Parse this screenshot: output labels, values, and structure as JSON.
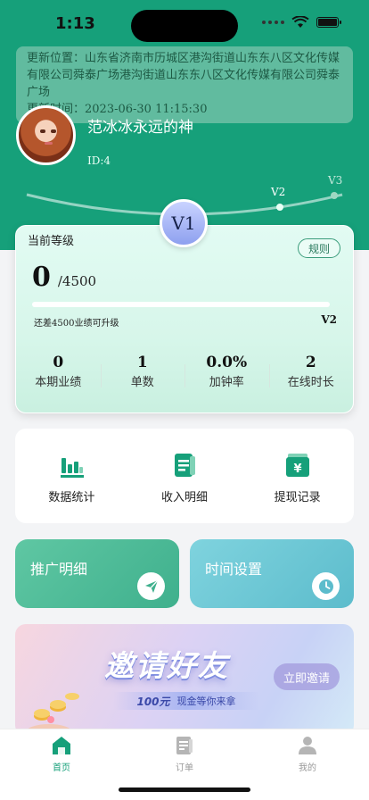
{
  "status_bar": {
    "time": "1:13"
  },
  "location": "更新位置：山东省济南市历城区港沟街道山东东八区文化传媒有限公司舜泰广场港沟街道山东东八区文化传媒有限公司舜泰广场",
  "update_time": "更新时间：2023-06-30 11:15:30",
  "profile": {
    "name": "范冰冰永远的神",
    "id": "ID:4"
  },
  "levels": {
    "current": "V1",
    "next": "V2",
    "after": "V3"
  },
  "level_card": {
    "title": "当前等级",
    "rules_label": "规则",
    "score": "0",
    "total": "/4500",
    "progress": 0,
    "need_text": "还差4500业绩可升级",
    "next_level": "V2",
    "stats": [
      {
        "value": "0",
        "label": "本期业绩"
      },
      {
        "value": "1",
        "label": "单数"
      },
      {
        "value": "0.0%",
        "label": "加钟率"
      },
      {
        "value": "2",
        "label": "在线时长"
      }
    ]
  },
  "menu": [
    {
      "label": "数据统计",
      "icon": "bar-chart-icon"
    },
    {
      "label": "收入明细",
      "icon": "document-icon"
    },
    {
      "label": "提现记录",
      "icon": "wallet-yen-icon"
    }
  ],
  "tiles": {
    "promo": {
      "label": "推广明细",
      "icon": "paper-plane-icon"
    },
    "time": {
      "label": "时间设置",
      "icon": "clock-icon"
    }
  },
  "banner": {
    "title": "邀请好友",
    "amount": "100元",
    "subtitle": "现金等你来拿",
    "button": "立即邀请"
  },
  "tabbar": [
    {
      "label": "首页",
      "icon": "home-icon",
      "active": true
    },
    {
      "label": "订单",
      "icon": "order-icon",
      "active": false
    },
    {
      "label": "我的",
      "icon": "profile-icon",
      "active": false
    }
  ],
  "colors": {
    "primary": "#16a07a",
    "background": "#f3f4f6",
    "promo_tile": "#4dbb96",
    "time_tile": "#6cc6d4"
  }
}
